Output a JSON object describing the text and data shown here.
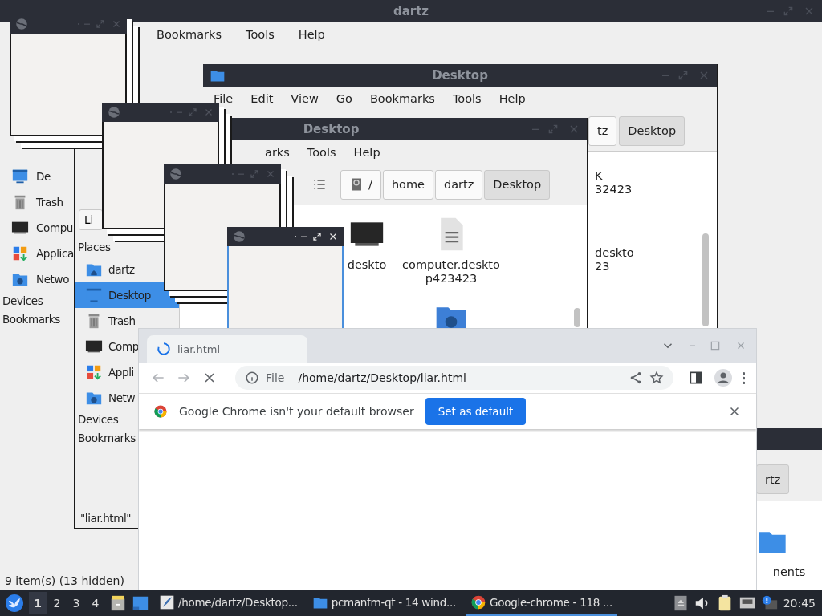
{
  "back_window": {
    "title": "dartz",
    "menu": [
      "Bookmarks",
      "Tools",
      "Help"
    ],
    "places": [
      {
        "label": "De",
        "kind": "desktop"
      },
      {
        "label": "Trash",
        "kind": "trash"
      },
      {
        "label": "Compu",
        "kind": "computer"
      },
      {
        "label": "Applica",
        "kind": "apps"
      },
      {
        "label": "Netwo",
        "kind": "network"
      }
    ],
    "sections": [
      "Devices",
      "Bookmarks"
    ],
    "status": "9 item(s) (13 hidden)"
  },
  "corner_window": {
    "crumb": "rtz",
    "file": "nents"
  },
  "desktop_window": {
    "title": "Desktop",
    "menu": [
      "File",
      "Edit",
      "View",
      "Go",
      "Bookmarks",
      "Tools",
      "Help"
    ],
    "crumbs": [
      {
        "label": "tz",
        "selected": false
      },
      {
        "label": "Desktop",
        "selected": true
      }
    ],
    "files": [
      {
        "lines": [
          "K",
          "32423"
        ]
      },
      {
        "lines": [
          "deskto",
          "23"
        ]
      }
    ]
  },
  "front_window": {
    "title": "Desktop",
    "menu": [
      "arks",
      "Tools",
      "Help"
    ],
    "view_button": "Li",
    "places_heading": "Places",
    "places": [
      {
        "label": "dartz",
        "kind": "home",
        "selected": false
      },
      {
        "label": "Desktop",
        "kind": "desktop",
        "selected": true
      },
      {
        "label": "Trash",
        "kind": "trash",
        "selected": false
      },
      {
        "label": "Comp",
        "kind": "computer",
        "selected": false
      },
      {
        "label": "Appli",
        "kind": "apps",
        "selected": false
      },
      {
        "label": "Netw",
        "kind": "network",
        "selected": false
      }
    ],
    "sections": [
      "Devices",
      "Bookmarks"
    ],
    "crumbs": [
      {
        "label": "/",
        "kind": "drive",
        "selected": false
      },
      {
        "label": "home",
        "selected": false
      },
      {
        "label": "dartz",
        "selected": false
      },
      {
        "label": "Desktop",
        "selected": true
      }
    ],
    "files": [
      {
        "kind": "computer",
        "lines": [
          "deskto"
        ]
      },
      {
        "kind": "document",
        "lines": [
          "computer.deskto",
          "p423423"
        ]
      },
      {
        "kind": "network-folder"
      }
    ],
    "status": "\"liar.html\""
  },
  "blank_windows": [
    {
      "focused": false
    },
    {
      "focused": false
    },
    {
      "focused": false
    },
    {
      "focused": true
    }
  ],
  "browser": {
    "tab": "liar.html",
    "scheme": "File",
    "url": "/home/dartz/Desktop/liar.html",
    "infobar": {
      "message": "Google Chrome isn't your default browser",
      "button": "Set as default"
    }
  },
  "taskbar": {
    "workspaces": [
      {
        "label": "1",
        "selected": true
      },
      {
        "label": "2",
        "selected": false
      },
      {
        "label": "3",
        "selected": false
      },
      {
        "label": "4",
        "selected": false
      }
    ],
    "tasks": [
      {
        "label": "/home/dartz/Desktop...",
        "kind": "editor",
        "selected": false
      },
      {
        "label": "pcmanfm-qt - 14 wind...",
        "kind": "folder",
        "selected": false
      },
      {
        "label": "Google-chrome - 118 ...",
        "kind": "chrome",
        "selected": true
      }
    ],
    "clock": "20:45"
  }
}
